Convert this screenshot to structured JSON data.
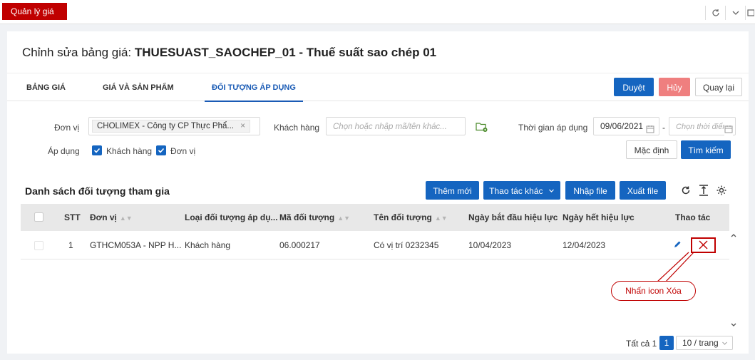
{
  "app": {
    "tab_label": "Quản lý giá"
  },
  "page": {
    "title_prefix": "Chỉnh sửa bảng giá:",
    "title_name": "THUESUAST_SAOCHEP_01 - Thuế suất sao chép 01"
  },
  "tabs": [
    {
      "label": "BẢNG GIÁ",
      "active": false
    },
    {
      "label": "GIÁ VÀ SẢN PHẨM",
      "active": false
    },
    {
      "label": "ĐỐI TƯỢNG ÁP DỤNG",
      "active": true
    }
  ],
  "actions": {
    "approve": "Duyệt",
    "cancel": "Hủy",
    "back": "Quay lại"
  },
  "filters": {
    "unit_label": "Đơn vị",
    "unit_value": "CHOLIMEX - Công ty CP Thực Phẩ...",
    "customer_label": "Khách hàng",
    "customer_placeholder": "Chọn hoặc nhập mã/tên khác...",
    "period_label": "Thời gian áp dụng",
    "date_from": "09/06/2021",
    "date_separator": "-",
    "date_to_placeholder": "Chọn thời điểm",
    "apply_label": "Áp dụng",
    "apply_customer": "Khách hàng",
    "apply_unit": "Đơn vị",
    "default_button": "Mặc định",
    "search_button": "Tìm kiếm"
  },
  "list": {
    "title": "Danh sách đối tượng tham gia",
    "add_button": "Thêm mới",
    "more_button": "Thao tác khác",
    "import_button": "Nhập file",
    "export_button": "Xuất file"
  },
  "table": {
    "headers": {
      "stt": "STT",
      "unit": "Đơn vị",
      "type": "Loại đối tượng áp dụ...",
      "code": "Mã đối tượng",
      "name": "Tên đối tượng",
      "start": "Ngày bắt đầu hiệu lực",
      "end": "Ngày hết hiệu lực",
      "actions": "Thao tác"
    },
    "rows": [
      {
        "stt": "1",
        "unit": "GTHCM053A - NPP H...",
        "type": "Khách hàng",
        "code": "06.000217",
        "name": "Có vị trí 0232345",
        "start": "10/04/2023",
        "end": "12/04/2023"
      }
    ]
  },
  "annotation": {
    "text": "Nhấn icon Xóa",
    "color": "#c00000"
  },
  "pagination": {
    "total": "Tất cả 1",
    "current_page": "1",
    "page_size": "10 / trang"
  },
  "colors": {
    "brand_red": "#c00000",
    "primary": "#1565c0",
    "danger": "#ef7f7f"
  },
  "icons": [
    "refresh-icon",
    "chevron-down-icon",
    "expand-icon",
    "calendar-icon",
    "folder-add-icon",
    "checkmark-icon",
    "reload-icon",
    "column-height-icon",
    "settings-icon",
    "sort-icon",
    "edit-icon",
    "delete-icon",
    "close-icon"
  ]
}
